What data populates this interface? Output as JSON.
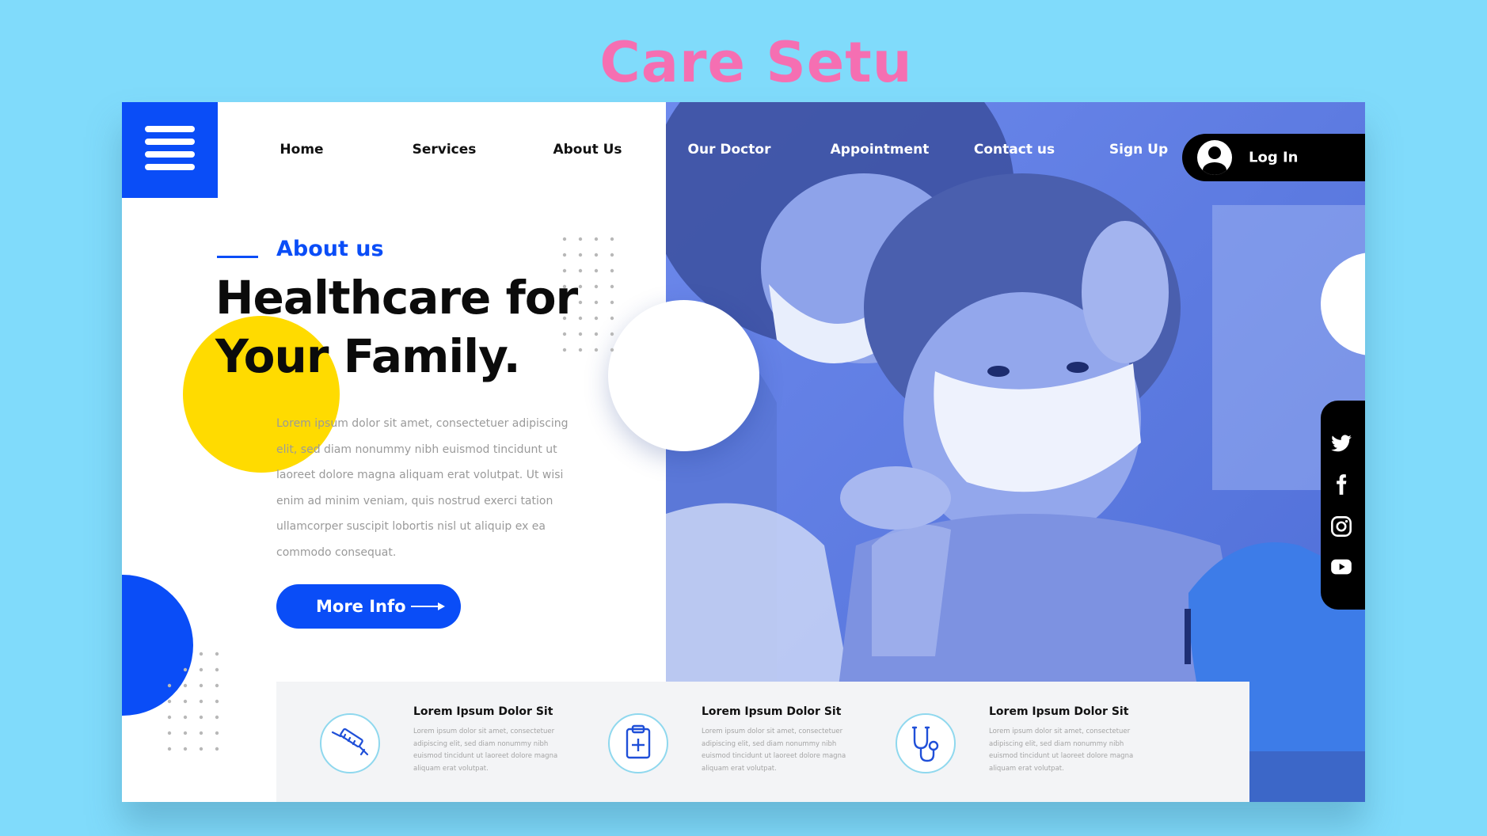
{
  "page_title": "Care Setu",
  "nav": {
    "items": [
      {
        "label": "Home"
      },
      {
        "label": "Services"
      },
      {
        "label": "About Us"
      },
      {
        "label": "Our Doctor"
      },
      {
        "label": "Appointment"
      },
      {
        "label": "Contact us"
      },
      {
        "label": "Sign Up"
      }
    ],
    "login_label": "Log In",
    "menu_icon": "hamburger-icon",
    "login_icon": "user-avatar-icon"
  },
  "hero": {
    "section_label": "About us",
    "headline_line1": "Healthcare for",
    "headline_line2": "Your Family.",
    "body": "Lorem ipsum dolor sit amet, consectetuer adipiscing elit, sed diam nonummy nibh euismod tincidunt ut laoreet dolore magna aliquam erat volutpat. Ut wisi enim ad minim veniam, quis nostrud exerci tation ullamcorper suscipit lobortis nisl ut aliquip ex ea commodo consequat.",
    "cta_label": "More Info",
    "image_description_icon": "mother-child-vaccination-photo"
  },
  "social": [
    {
      "icon": "twitter-icon"
    },
    {
      "icon": "facebook-icon"
    },
    {
      "icon": "instagram-icon"
    },
    {
      "icon": "youtube-icon"
    }
  ],
  "features": [
    {
      "icon": "syringe-icon",
      "title": "Lorem Ipsum Dolor Sit",
      "desc": "Lorem ipsum dolor sit amet, consectetuer adipiscing elit, sed diam nonummy nibh euismod tincidunt ut laoreet dolore magna aliquam erat volutpat."
    },
    {
      "icon": "medical-clipboard-icon",
      "title": "Lorem Ipsum Dolor Sit",
      "desc": "Lorem ipsum dolor sit amet, consectetuer adipiscing elit, sed diam nonummy nibh euismod tincidunt ut laoreet dolore magna aliquam erat volutpat."
    },
    {
      "icon": "stethoscope-icon",
      "title": "Lorem Ipsum Dolor Sit",
      "desc": "Lorem ipsum dolor sit amet, consectetuer adipiscing elit, sed diam nonummy nibh euismod tincidunt ut laoreet dolore magna aliquam erat volutpat."
    }
  ],
  "colors": {
    "background": "#80dbfb",
    "brand_pink": "#f56fb2",
    "primary_blue": "#0a4df7",
    "accent_yellow": "#ffdb00",
    "dark": "#000000"
  }
}
